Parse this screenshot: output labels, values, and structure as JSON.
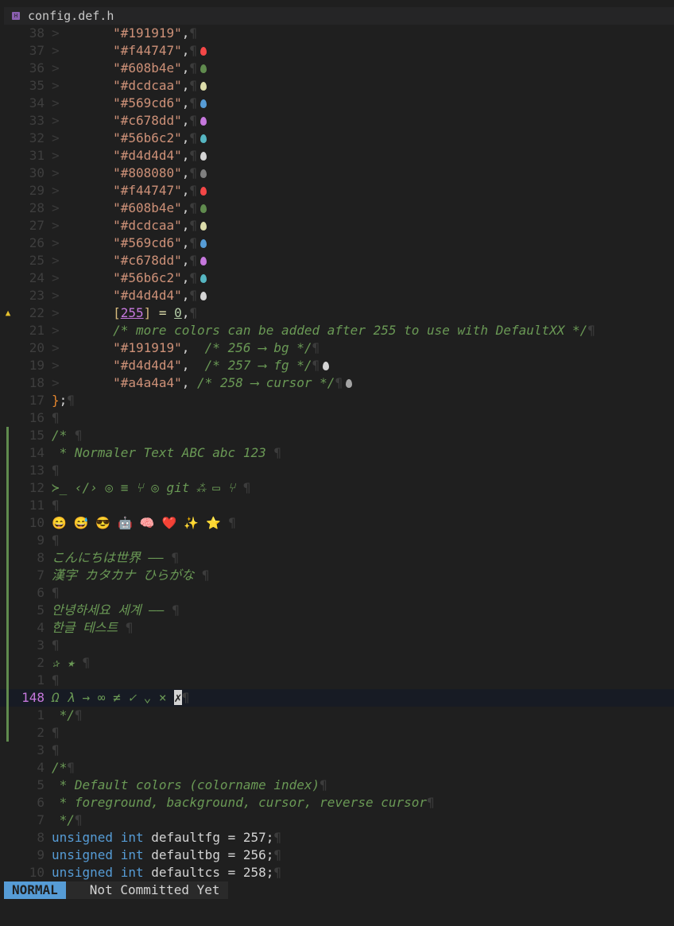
{
  "tab": {
    "icon": "header-file-icon",
    "filename": "config.def.h"
  },
  "status": {
    "mode": "NORMAL",
    "blame": "Not Committed Yet"
  },
  "colors": {
    "bg": "#1f1f1f",
    "string": "#ce9178",
    "comment": "#6a9955",
    "keyword": "#569cd6",
    "mode_bg": "#569cd6"
  },
  "lines": [
    {
      "num": "38",
      "indent": ">       ",
      "text": "\"#191919\",",
      "pil": "¶",
      "swatch": ""
    },
    {
      "num": "37",
      "indent": ">       ",
      "text": "\"#f44747\",",
      "pil": "¶",
      "swatch": "#f44747"
    },
    {
      "num": "36",
      "indent": ">       ",
      "text": "\"#608b4e\",",
      "pil": "¶",
      "swatch": "#608b4e"
    },
    {
      "num": "35",
      "indent": ">       ",
      "text": "\"#dcdcaa\",",
      "pil": "¶",
      "swatch": "#dcdcaa"
    },
    {
      "num": "34",
      "indent": ">       ",
      "text": "\"#569cd6\",",
      "pil": "¶",
      "swatch": "#569cd6"
    },
    {
      "num": "33",
      "indent": ">       ",
      "text": "\"#c678dd\",",
      "pil": "¶",
      "swatch": "#c678dd"
    },
    {
      "num": "32",
      "indent": ">       ",
      "text": "\"#56b6c2\",",
      "pil": "¶",
      "swatch": "#56b6c2"
    },
    {
      "num": "31",
      "indent": ">       ",
      "text": "\"#d4d4d4\",",
      "pil": "¶",
      "swatch": "#d4d4d4"
    },
    {
      "num": "30",
      "indent": ">       ",
      "text": "\"#808080\",",
      "pil": "¶",
      "swatch": "#808080"
    },
    {
      "num": "29",
      "indent": ">       ",
      "text": "\"#f44747\",",
      "pil": "¶",
      "swatch": "#f44747"
    },
    {
      "num": "28",
      "indent": ">       ",
      "text": "\"#608b4e\",",
      "pil": "¶",
      "swatch": "#608b4e"
    },
    {
      "num": "27",
      "indent": ">       ",
      "text": "\"#dcdcaa\",",
      "pil": "¶",
      "swatch": "#dcdcaa"
    },
    {
      "num": "26",
      "indent": ">       ",
      "text": "\"#569cd6\",",
      "pil": "¶",
      "swatch": "#569cd6"
    },
    {
      "num": "25",
      "indent": ">       ",
      "text": "\"#c678dd\",",
      "pil": "¶",
      "swatch": "#c678dd"
    },
    {
      "num": "24",
      "indent": ">       ",
      "text": "\"#56b6c2\",",
      "pil": "¶",
      "swatch": "#56b6c2"
    },
    {
      "num": "23",
      "indent": ">       ",
      "text": "\"#d4d4d4\",",
      "pil": "¶",
      "swatch": "#d4d4d4"
    }
  ],
  "line22": {
    "num": "22",
    "sign": "▲",
    "indent": ">       ",
    "open": "[",
    "idx": "255",
    "close": "]",
    "eq": "=",
    "val": "0",
    "tail": ",",
    "pil": "¶"
  },
  "line21": {
    "num": "21",
    "indent": ">       ",
    "text": "/* more colors can be added after 255 to use with DefaultXX */",
    "pil": "¶"
  },
  "line20": {
    "num": "20",
    "indent": ">       ",
    "str": "\"#191919\",",
    "cmt": "  /* 256 ⟶ bg */",
    "pil": "¶"
  },
  "line19": {
    "num": "19",
    "indent": ">       ",
    "str": "\"#d4d4d4\",",
    "cmt": "  /* 257 ⟶ fg */",
    "pil": "¶",
    "swatch": "#d4d4d4"
  },
  "line18": {
    "num": "18",
    "indent": ">       ",
    "str": "\"#a4a4a4\",",
    "cmt": " /* 258 ⟶ cursor */",
    "pil": "¶",
    "swatch": "#a4a4a4"
  },
  "line17": {
    "num": "17",
    "brace": "}",
    "semi": ";",
    "pil": "¶"
  },
  "line16": {
    "num": "16",
    "pil": "¶"
  },
  "comment_lines": [
    {
      "num": "15",
      "text": "/*",
      "pil": "¶"
    },
    {
      "num": "14",
      "text": " * Normaler Text ABC abc 123",
      "pil": "¶"
    },
    {
      "num": "13",
      "text": "",
      "pil": "¶"
    },
    {
      "num": "12",
      "text": "≻_ ‹/› ◎ ≡ ⑂ ◎ git ⁂ ▭ ⑂",
      "pil": "¶"
    },
    {
      "num": "11",
      "text": "",
      "pil": "¶"
    },
    {
      "num": "10",
      "text": "😄 😅 😎 🤖 🧠 ❤️ ✨ ⭐",
      "pil": "¶"
    },
    {
      "num": "9",
      "text": "",
      "pil": "¶"
    },
    {
      "num": "8",
      "text": "こんにちは世界 ——",
      "pil": "¶"
    },
    {
      "num": "7",
      "text": "漢字 カタカナ ひらがな",
      "pil": "¶"
    },
    {
      "num": "6",
      "text": "",
      "pil": "¶"
    },
    {
      "num": "5",
      "text": "안녕하세요 세계 ——",
      "pil": "¶"
    },
    {
      "num": "4",
      "text": "한글 테스트",
      "pil": "¶"
    },
    {
      "num": "3",
      "text": "",
      "pil": "¶"
    },
    {
      "num": "2",
      "text": "✰ ★",
      "pil": "¶"
    },
    {
      "num": "1",
      "text": "",
      "pil": "¶"
    }
  ],
  "current_line": {
    "num": "148",
    "text": "Ω λ → ∞ ≠ ✓ ⌄ ×",
    "cursor": "✗",
    "pil": "¶"
  },
  "after_lines": [
    {
      "num": "1",
      "text": " */",
      "pil": "¶",
      "cls": "cmt"
    },
    {
      "num": "2",
      "text": "",
      "pil": "¶",
      "cls": "cmt"
    },
    {
      "num": "3",
      "text": "",
      "pil": "¶",
      "cls": "cmt"
    },
    {
      "num": "4",
      "text": "/*",
      "pil": "¶",
      "cls": "cmt"
    },
    {
      "num": "5",
      "text": " * Default colors (colorname index)",
      "pil": "¶",
      "cls": "cmt"
    },
    {
      "num": "6",
      "text": " * foreground, background, cursor, reverse cursor",
      "pil": "¶",
      "cls": "cmt"
    },
    {
      "num": "7",
      "text": " */",
      "pil": "¶",
      "cls": "cmt"
    }
  ],
  "decl_lines": [
    {
      "num": "8",
      "kw1": "unsigned",
      "kw2": "int",
      "rest": "defaultfg = 257;",
      "pil": "¶"
    },
    {
      "num": "9",
      "kw1": "unsigned",
      "kw2": "int",
      "rest": "defaultbg = 256;",
      "pil": "¶"
    },
    {
      "num": "10",
      "kw1": "unsigned",
      "kw2": "int",
      "rest": "defaultcs = 258;",
      "pil": "¶"
    }
  ]
}
